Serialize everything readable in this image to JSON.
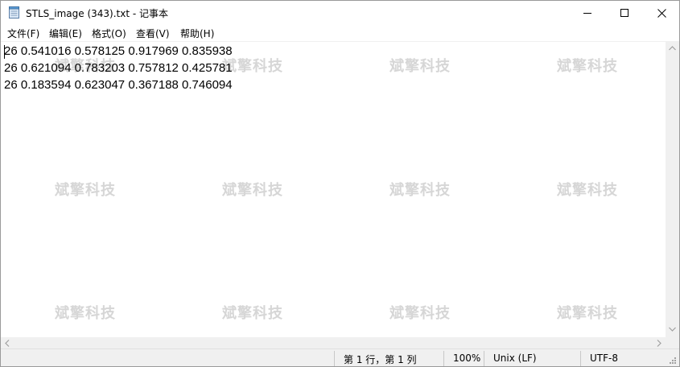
{
  "window": {
    "title": "STLS_image (343).txt - 记事本",
    "app_icon": "notepad-icon"
  },
  "menu": {
    "items": [
      {
        "label": "文件(F)"
      },
      {
        "label": "编辑(E)"
      },
      {
        "label": "格式(O)"
      },
      {
        "label": "查看(V)"
      },
      {
        "label": "帮助(H)"
      }
    ]
  },
  "editor": {
    "lines": [
      "26 0.541016 0.578125 0.917969 0.835938",
      "26 0.621094 0.783203 0.757812 0.425781",
      "26 0.183594 0.623047 0.367188 0.746094"
    ],
    "watermark_text": "斌擎科技"
  },
  "statusbar": {
    "position": "第 1 行，第 1 列",
    "zoom": "100%",
    "line_ending": "Unix (LF)",
    "encoding": "UTF-8"
  },
  "colors": {
    "watermark": "#c9c9c9",
    "chrome": "#f0f0f0"
  }
}
